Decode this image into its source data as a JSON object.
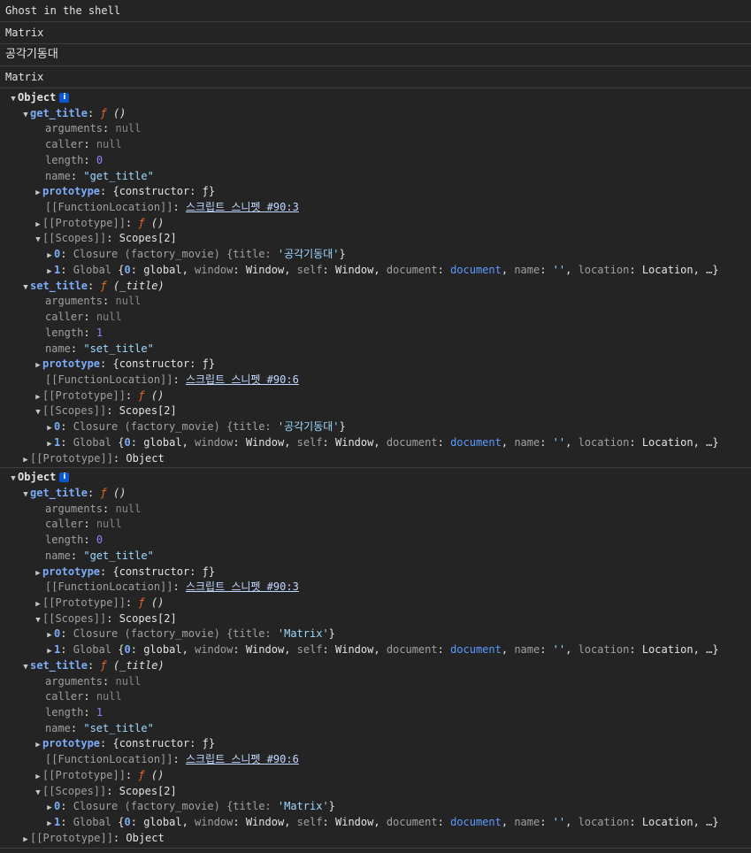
{
  "logs": [
    "Ghost in the shell",
    "Matrix",
    "공각기동대",
    "Matrix"
  ],
  "objects": [
    {
      "label": "Object",
      "info_icon": "i",
      "getter": {
        "key": "get_title",
        "sig": "ƒ ()",
        "arguments": "null",
        "caller": "null",
        "length": "0",
        "name": "\"get_title\"",
        "prototype_value": "{constructor: ƒ}",
        "location_key": "[[FunctionLocation]]",
        "location_link": "스크립트 스니펫 #90:3",
        "proto_key": "[[Prototype]]",
        "proto_val": "ƒ ()",
        "scopes_key": "[[Scopes]]",
        "scopes_val": "Scopes[2]",
        "scope0_idx": "0",
        "scope0_text": "Closure (factory_movie) {title: ",
        "scope0_title": "'공각기동대'",
        "scope0_end": "}",
        "scope1_idx": "1",
        "scope1_label": "Global"
      },
      "setter": {
        "key": "set_title",
        "sig": "ƒ (_title)",
        "arguments": "null",
        "caller": "null",
        "length": "1",
        "name": "\"set_title\"",
        "prototype_value": "{constructor: ƒ}",
        "location_key": "[[FunctionLocation]]",
        "location_link": "스크립트 스니펫 #90:6",
        "proto_key": "[[Prototype]]",
        "proto_val": "ƒ ()",
        "scopes_key": "[[Scopes]]",
        "scopes_val": "Scopes[2]",
        "scope0_idx": "0",
        "scope0_text": "Closure (factory_movie) {title: ",
        "scope0_title": "'공각기동대'",
        "scope0_end": "}",
        "scope1_idx": "1",
        "scope1_label": "Global"
      },
      "object_proto_key": "[[Prototype]]",
      "object_proto_val": "Object"
    },
    {
      "label": "Object",
      "info_icon": "i",
      "getter": {
        "key": "get_title",
        "sig": "ƒ ()",
        "arguments": "null",
        "caller": "null",
        "length": "0",
        "name": "\"get_title\"",
        "prototype_value": "{constructor: ƒ}",
        "location_key": "[[FunctionLocation]]",
        "location_link": "스크립트 스니펫 #90:3",
        "proto_key": "[[Prototype]]",
        "proto_val": "ƒ ()",
        "scopes_key": "[[Scopes]]",
        "scopes_val": "Scopes[2]",
        "scope0_idx": "0",
        "scope0_text": "Closure (factory_movie) {title: ",
        "scope0_title": "'Matrix'",
        "scope0_end": "}",
        "scope1_idx": "1",
        "scope1_label": "Global"
      },
      "setter": {
        "key": "set_title",
        "sig": "ƒ (_title)",
        "arguments": "null",
        "caller": "null",
        "length": "1",
        "name": "\"set_title\"",
        "prototype_value": "{constructor: ƒ}",
        "location_key": "[[FunctionLocation]]",
        "location_link": "스크립트 스니펫 #90:6",
        "proto_key": "[[Prototype]]",
        "proto_val": "ƒ ()",
        "scopes_key": "[[Scopes]]",
        "scopes_val": "Scopes[2]",
        "scope0_idx": "0",
        "scope0_text": "Closure (factory_movie) {title: ",
        "scope0_title": "'Matrix'",
        "scope0_end": "}",
        "scope1_idx": "1",
        "scope1_label": "Global"
      },
      "object_proto_key": "[[Prototype]]",
      "object_proto_val": "Object"
    }
  ],
  "labels": {
    "arguments": "arguments",
    "caller": "caller",
    "length": "length",
    "name": "name",
    "prototype": "prototype"
  },
  "global_props": [
    {
      "k": "0",
      "v": "global",
      "vc": "plain"
    },
    {
      "k": "window",
      "v": "Window",
      "vc": "plain"
    },
    {
      "k": "self",
      "v": "Window",
      "vc": "plain"
    },
    {
      "k": "document",
      "v": "document",
      "vc": "blue"
    },
    {
      "k": "name",
      "v": "''",
      "vc": "str"
    },
    {
      "k": "location",
      "v": "Location",
      "vc": "plain"
    }
  ],
  "global_ellipsis": "…}",
  "icons": {
    "expanded": "arrow-down",
    "collapsed": "arrow-right",
    "info": "info-badge"
  },
  "colors": {
    "background": "#242424",
    "key": "#7cacf8",
    "number": "#9980ff",
    "string": "#9cd9ff",
    "function": "#e9652a",
    "null": "#868686"
  }
}
